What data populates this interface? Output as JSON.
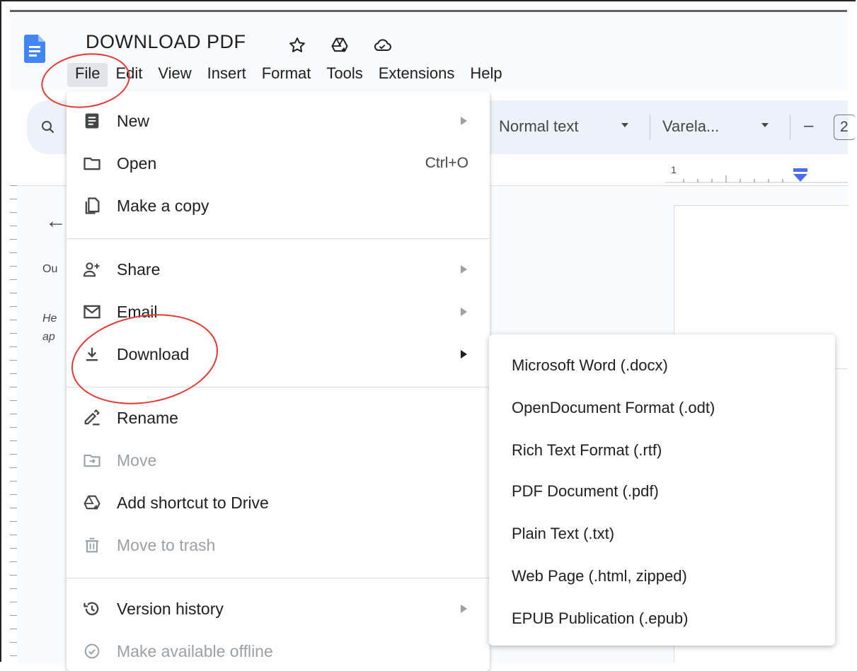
{
  "document": {
    "title": "DOWNLOAD PDF"
  },
  "menubar": [
    "File",
    "Edit",
    "View",
    "Insert",
    "Format",
    "Tools",
    "Extensions",
    "Help"
  ],
  "toolbar": {
    "style_label": "Normal text",
    "font_label": "Varela...",
    "minus_label": "–",
    "size_partial": "2"
  },
  "ruler": {
    "mark": "1"
  },
  "outline": {
    "heading": "Ou",
    "line1": "He",
    "line2": "ap"
  },
  "file_menu": {
    "items": [
      {
        "label": "New",
        "icon": "document-icon",
        "submenu": true
      },
      {
        "label": "Open",
        "icon": "folder-icon",
        "shortcut": "Ctrl+O"
      },
      {
        "label": "Make a copy",
        "icon": "copy-icon"
      },
      {
        "label": "Share",
        "icon": "person-add-icon",
        "submenu": true
      },
      {
        "label": "Email",
        "icon": "mail-icon",
        "submenu": true
      },
      {
        "label": "Download",
        "icon": "download-icon",
        "submenu": true,
        "active": true
      },
      {
        "label": "Rename",
        "icon": "pencil-icon"
      },
      {
        "label": "Move",
        "icon": "move-folder-icon",
        "disabled": true
      },
      {
        "label": "Add shortcut to Drive",
        "icon": "drive-shortcut-icon"
      },
      {
        "label": "Move to trash",
        "icon": "trash-icon",
        "disabled": true
      },
      {
        "label": "Version history",
        "icon": "history-icon",
        "submenu": true
      },
      {
        "label": "Make available offline",
        "icon": "offline-check-icon",
        "disabled": true
      }
    ]
  },
  "download_menu": {
    "items": [
      "Microsoft Word (.docx)",
      "OpenDocument Format (.odt)",
      "Rich Text Format (.rtf)",
      "PDF Document (.pdf)",
      "Plain Text (.txt)",
      "Web Page (.html, zipped)",
      "EPUB Publication (.epub)"
    ]
  },
  "colors": {
    "accent": "#4285f4",
    "annotation": "#e53935",
    "toolbar_bg": "#edf2fa"
  }
}
